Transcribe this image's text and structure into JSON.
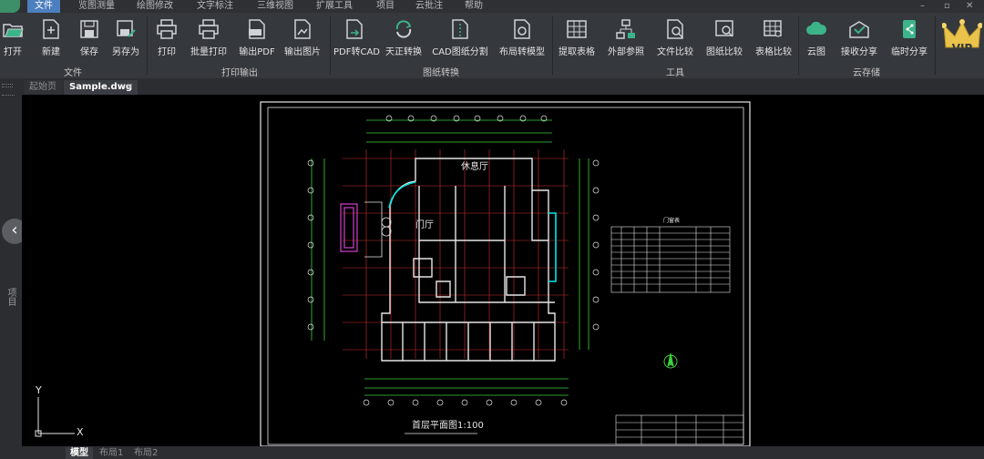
{
  "menu": {
    "items": [
      "文件",
      "览图测量",
      "绘图修改",
      "文字标注",
      "三维视图",
      "扩展工具",
      "项目",
      "云批注",
      "帮助"
    ],
    "active_index": 0
  },
  "ribbon": {
    "file_group": {
      "label": "文件",
      "buttons": [
        "打开",
        "新建",
        "保存",
        "另存为"
      ]
    },
    "print_group": {
      "label": "打印输出",
      "buttons": [
        "打印",
        "批量打印",
        "输出PDF",
        "输出图片"
      ]
    },
    "convert_group": {
      "label": "图纸转换",
      "buttons": [
        "PDF转CAD",
        "天正转换",
        "CAD图纸分割",
        "布局转模型"
      ]
    },
    "tools_group": {
      "label": "工具",
      "buttons": [
        "提取表格",
        "外部参照",
        "文件比较",
        "图纸比较",
        "表格比较"
      ]
    },
    "cloud_group": {
      "label": "云存储",
      "buttons": [
        "云图",
        "接收分享",
        "临时分享"
      ]
    },
    "vip_label": "VIP"
  },
  "tabs": {
    "start": "起始页",
    "doc": "Sample.dwg",
    "close": "×"
  },
  "side": {
    "label": "项目",
    "back": "‹"
  },
  "drawing": {
    "title": "首层平面图1:100",
    "room_rest": "休息厅",
    "room_hall": "门厅",
    "table_title": "门窗表"
  },
  "ucs": {
    "y": "Y",
    "x": "X"
  },
  "layouts": [
    "模型",
    "布局1",
    "布局2"
  ],
  "colors": {
    "accent": "#4c7fbf",
    "ribbon": "#35383c",
    "canvas": "#000000",
    "cyan": "#00e5e5",
    "red": "#d03030",
    "green": "#3ad23a",
    "magenta": "#d040d0"
  }
}
